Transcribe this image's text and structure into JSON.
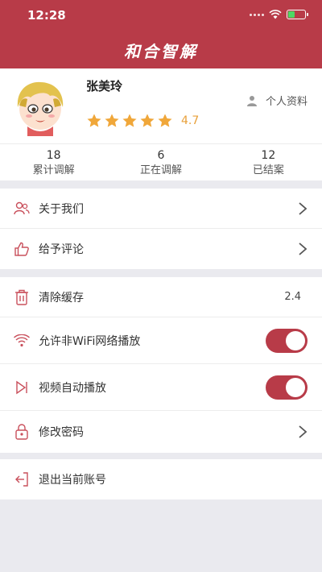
{
  "status_bar": {
    "time": "12:28"
  },
  "app": {
    "title": "和合智解"
  },
  "user": {
    "name": "张美玲",
    "rating": "4.7",
    "stars": 5,
    "profile_link": "个人资料"
  },
  "stats": [
    {
      "count": "18",
      "label": "累计调解"
    },
    {
      "count": "6",
      "label": "正在调解"
    },
    {
      "count": "12",
      "label": "已结案"
    }
  ],
  "menu": {
    "about": "关于我们",
    "review": "给予评论",
    "clear_cache": "清除缓存",
    "cache_size": "2.4",
    "allow_non_wifi": "允许非WiFi网络播放",
    "autoplay": "视频自动播放",
    "change_password": "修改密码",
    "logout": "退出当前账号"
  },
  "toggles": {
    "allow_non_wifi": true,
    "autoplay": true
  },
  "colors": {
    "brand": "#b83b48",
    "star": "#f0a73a",
    "background": "#eaeaef"
  }
}
